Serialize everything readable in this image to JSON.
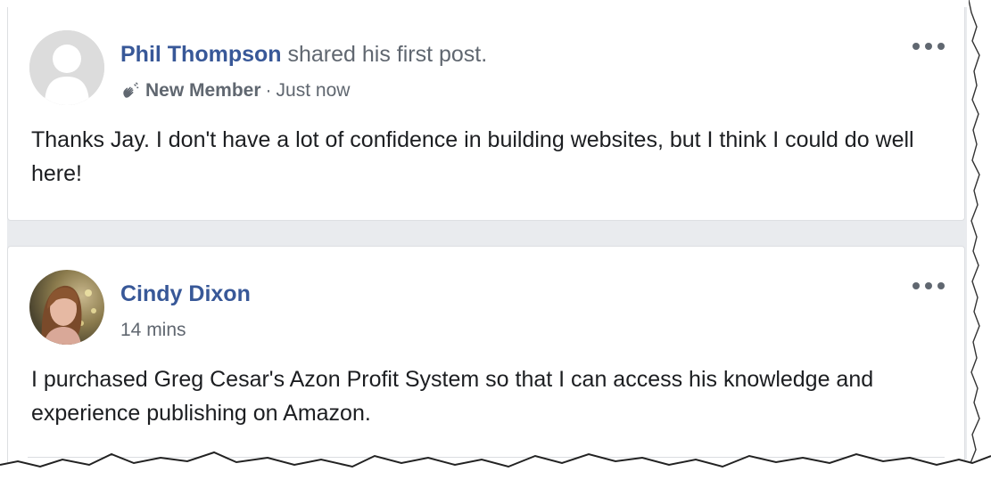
{
  "posts": [
    {
      "author": "Phil Thompson",
      "action": " shared his first post.",
      "badge": "New Member",
      "separator": "·",
      "time": "Just now",
      "text": "Thanks Jay. I don't have a lot of confidence in building websites, but I think I could do well here!"
    },
    {
      "author": "Cindy Dixon",
      "time": "14 mins",
      "text": "I purchased Greg Cesar's Azon Profit System so that I can access his knowledge and experience publishing on Amazon."
    }
  ],
  "colors": {
    "link_blue": "#385898",
    "secondary_text": "#606770",
    "primary_text": "#1c1e21",
    "feed_background": "#e9ebee",
    "card_border": "#dddfe2"
  },
  "icons": {
    "default_avatar": "default-profile-silhouette-icon",
    "badge": "waving-hand-icon",
    "more": "more-options-icon"
  }
}
